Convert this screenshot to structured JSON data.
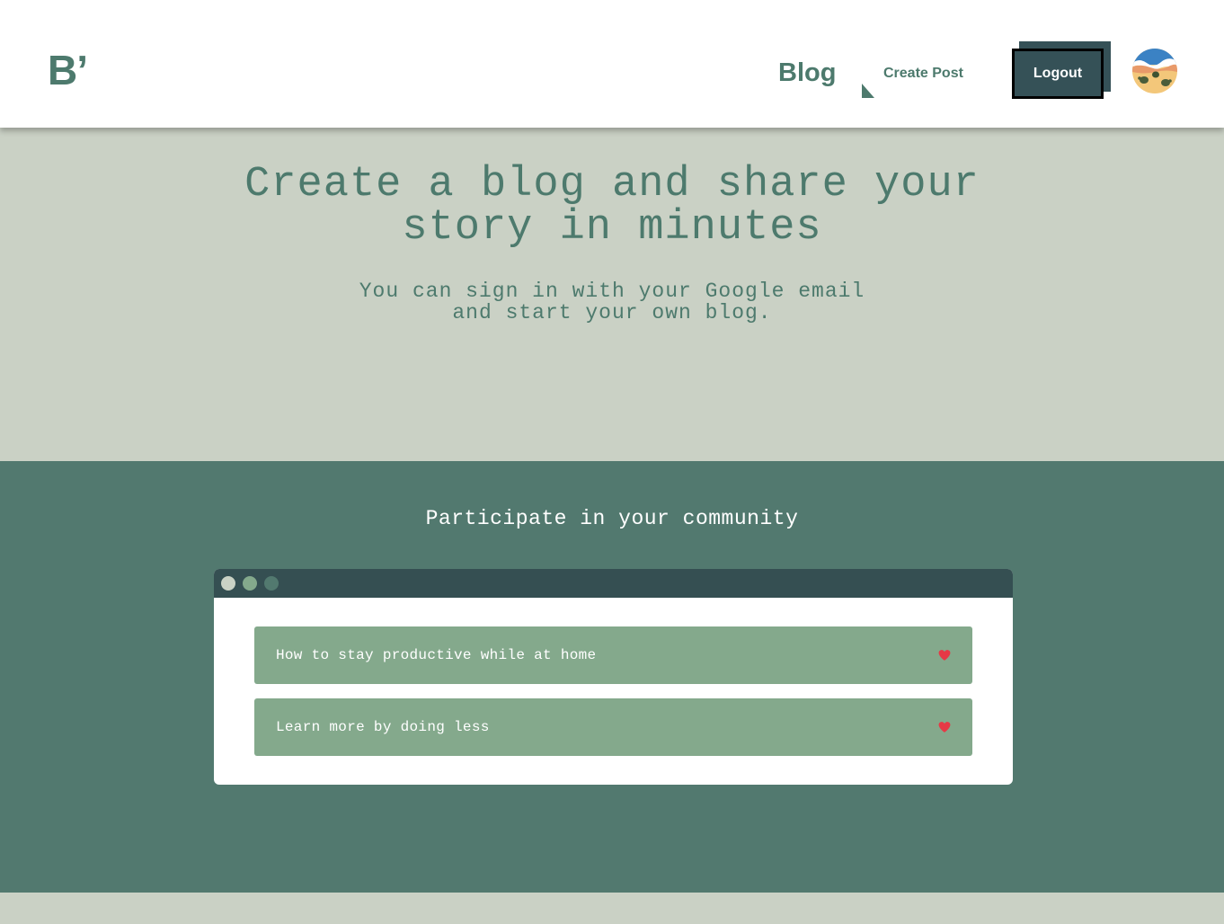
{
  "header": {
    "logo": "B’",
    "nav": {
      "blog": "Blog",
      "create_post": "Create Post"
    },
    "logout_label": "Logout",
    "avatar_icon": "avatar-turtles-beach"
  },
  "hero": {
    "title_lines": [
      "Create a blog and share your",
      "story in minutes"
    ],
    "subtitle_lines": [
      "You can sign in with your Google email",
      "and start your own blog."
    ]
  },
  "community": {
    "title": "Participate in your community",
    "window_dots": [
      "#cad2c5",
      "#84a98c",
      "#52796f"
    ],
    "posts": [
      {
        "title": "How to stay productive while at home",
        "icon": "heart-icon"
      },
      {
        "title": "Learn more by doing less",
        "icon": "heart-icon"
      }
    ]
  },
  "colors": {
    "primary": "#4d7a6d",
    "dark": "#354f52",
    "background": "#cad2c5",
    "community_bg": "#52796f",
    "post_bg": "#84a98c",
    "heart": "#e63946"
  }
}
